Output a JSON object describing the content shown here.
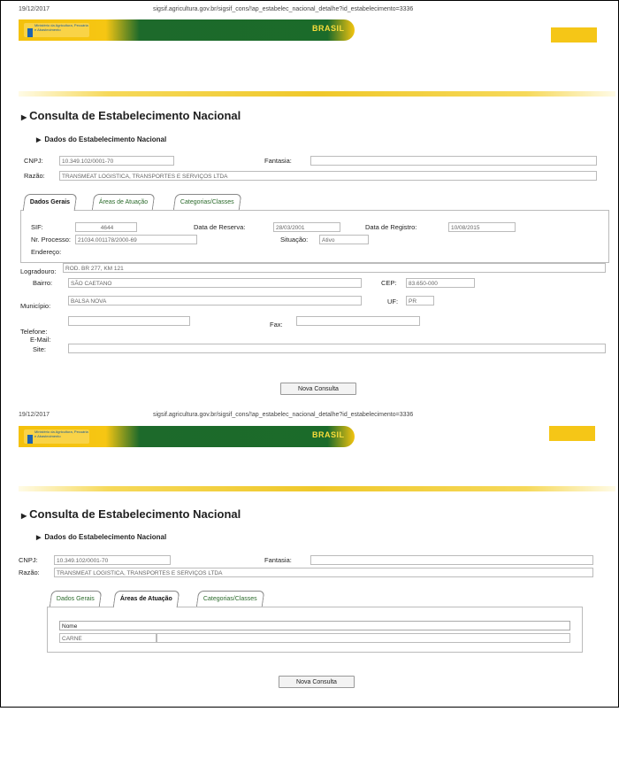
{
  "pages": [
    {
      "date": "19/12/2017",
      "url": "sigsif.agricultura.gov.br/sigsif_cons/!ap_estabelec_nacional_detalhe?id_estabelecimento=3336",
      "banner_logo": "Ministério da Agricultura, Pecuária e Abastecimento",
      "banner_brand": "BRASIL",
      "title": "Consulta de Estabelecimento Nacional",
      "subtitle": "Dados do Estabelecimento Nacional",
      "cnpj_label": "CNPJ:",
      "cnpj_value": "10.349.102/0001-70",
      "fantasia_label": "Fantasia:",
      "fantasia_value": "",
      "razao_label": "Razão:",
      "razao_value": "TRANSMEAT LOGISTICA, TRANSPORTES E SERVIÇOS LTDA",
      "tabs": [
        "Dados Gerais",
        "Áreas de Atuação",
        "Categorias/Classes"
      ],
      "active_tab": 0,
      "sif_label": "SIF:",
      "sif_value": "4644",
      "data_reserva_label": "Data de Reserva:",
      "data_reserva_value": "28/03/2001",
      "data_registro_label": "Data de Registro:",
      "data_registro_value": "10/08/2015",
      "nr_processo_label": "Nr. Processo:",
      "nr_processo_value": "21034.001178/2000-69",
      "situacao_label": "Situação:",
      "situacao_value": "Ativo",
      "endereco_label": "Endereço:",
      "logradouro_label": "Logradouro:",
      "logradouro_value": "ROD. BR 277, KM 121",
      "bairro_label": "Bairro:",
      "bairro_value": "SÃO CAETANO",
      "cep_label": "CEP:",
      "cep_value": "83.650-000",
      "municipio_label": "Município:",
      "municipio_value": "BALSA NOVA",
      "uf_label": "UF:",
      "uf_value": "PR",
      "telefone_label": "Telefone:",
      "fax_label": "Fax:",
      "email_label": "E-Mail:",
      "site_label": "Site:",
      "button_label": "Nova Consulta"
    },
    {
      "date": "19/12/2017",
      "url": "sigsif.agricultura.gov.br/sigsif_cons/!ap_estabelec_nacional_detalhe?id_estabelecimento=3336",
      "banner_logo": "Ministério da Agricultura, Pecuária e Abastecimento",
      "banner_brand": "BRASIL",
      "title": "Consulta de Estabelecimento Nacional",
      "subtitle": "Dados do Estabelecimento Nacional",
      "cnpj_label": "CNPJ:",
      "cnpj_value": "10.349.102/0001-70",
      "fantasia_label": "Fantasia:",
      "fantasia_value": "",
      "razao_label": "Razão:",
      "razao_value": "TRANSMEAT LOGISTICA, TRANSPORTES E SERVIÇOS LTDA",
      "tabs": [
        "Dados Gerais",
        "Áreas de Atuação",
        "Categorias/Classes"
      ],
      "active_tab": 1,
      "table_header": "Nome",
      "table_rows": [
        "CARNE"
      ],
      "button_label": "Nova Consulta"
    }
  ]
}
